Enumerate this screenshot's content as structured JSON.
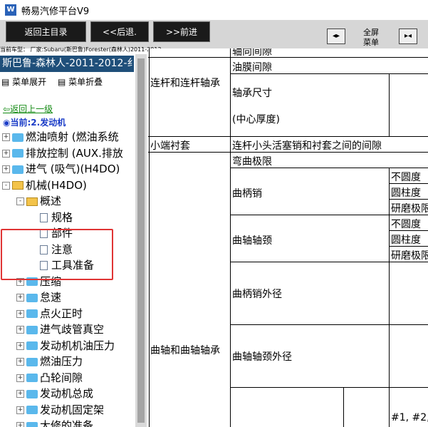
{
  "window": {
    "title": "畅易汽修平台V9",
    "icon": "app-logo-icon"
  },
  "toolbar": {
    "home_label": "返回主目录",
    "back_label": "<<后退.",
    "forward_label": ">>前进",
    "fullscreen_label": "全屏菜单"
  },
  "vehicle_line": "当前车型： 厂家:Subaru(斯巴鲁)Forester(森林人)2011-2012",
  "sidebar": {
    "vehicle_title": "斯巴鲁-森林人-2011-2012-纟",
    "expand_label": "菜单展开",
    "collapse_label": "菜单折叠",
    "back_up_label": "返回上一级",
    "current_label": "当前:2.发动机",
    "tree": [
      {
        "label": "燃油喷射 (燃油系统",
        "icon": "folder-icon",
        "expander": "+"
      },
      {
        "label": "排放控制 (AUX.排放",
        "icon": "folder-icon",
        "expander": "+"
      },
      {
        "label": "进气 (吸气)(H4DO)",
        "icon": "folder-icon",
        "expander": "+"
      },
      {
        "label": "机械(H4DO)",
        "icon": "open-book-icon",
        "expander": "-"
      },
      {
        "label": "概述",
        "icon": "open-book-icon",
        "expander": "-"
      },
      {
        "label": "规格",
        "icon": "document-icon"
      },
      {
        "label": "部件",
        "icon": "document-icon"
      },
      {
        "label": "注意",
        "icon": "document-icon"
      },
      {
        "label": "工具准备",
        "icon": "document-icon"
      },
      {
        "label": "压缩",
        "icon": "folder-icon",
        "expander": "+"
      },
      {
        "label": "怠速",
        "icon": "folder-icon",
        "expander": "+"
      },
      {
        "label": "点火正时",
        "icon": "folder-icon",
        "expander": "+"
      },
      {
        "label": "进气歧管真空",
        "icon": "folder-icon",
        "expander": "+"
      },
      {
        "label": "发动机机油压力",
        "icon": "folder-icon",
        "expander": "+"
      },
      {
        "label": "燃油压力",
        "icon": "folder-icon",
        "expander": "+"
      },
      {
        "label": "凸轮间隙",
        "icon": "folder-icon",
        "expander": "+"
      },
      {
        "label": "发动机总成",
        "icon": "folder-icon",
        "expander": "+"
      },
      {
        "label": "发动机固定架",
        "icon": "folder-icon",
        "expander": "+"
      },
      {
        "label": "大修的准备",
        "icon": "folder-icon",
        "expander": "+"
      }
    ]
  },
  "spec_table": {
    "partial_top": "轴向间隙",
    "oil_clearance": "油膜间隙",
    "conrod_bearing": "连杆和连杆轴承",
    "bearing_size": "轴承尺寸",
    "center_thickness": "(中心厚度)",
    "small_end_bushing": "小端衬套",
    "bushing_clearance": "连杆小头活塞销和衬套之间的间隙",
    "bend_limit": "弯曲极限",
    "crankpin": "曲柄销",
    "out_of_round": "不圆度",
    "cylindricity": "圆柱度",
    "grinding_limit": "研磨极限",
    "journal": "曲轴轴颈",
    "crankpin_od": "曲柄销外径",
    "crank_and_bearing": "曲轴和曲轴轴承",
    "journal_od": "曲轴轴颈外径",
    "journal_numbers": "#1, #2,"
  },
  "colors": {
    "vehicle_bar": "#1f4f7a",
    "highlight_box": "#e03434",
    "folder": "#5ab8ec",
    "back_link": "#138a13",
    "current": "#1a3cc7"
  }
}
